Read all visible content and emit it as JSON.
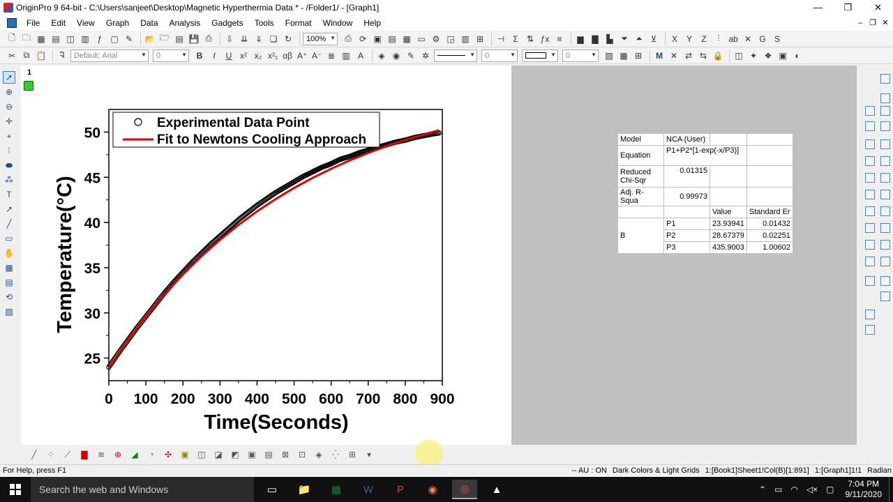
{
  "window": {
    "title": "OriginPro 9 64-bit - C:\\Users\\sanjeet\\Desktop\\Magnetic Hyperthermia Data * - /Folder1/ - [Graph1]",
    "minimize": "—",
    "maximize": "❐",
    "close": "✕"
  },
  "menu": {
    "items": [
      "File",
      "Edit",
      "View",
      "Graph",
      "Data",
      "Analysis",
      "Gadgets",
      "Tools",
      "Format",
      "Window",
      "Help"
    ],
    "mdi_min": "–",
    "mdi_restore": "❐",
    "mdi_close": "✕"
  },
  "toolbar": {
    "zoom": "100%",
    "font_name": "Default: Arial",
    "font_size": "0",
    "line_width": "0",
    "border_width": "0"
  },
  "page": {
    "layer_number": "1"
  },
  "chart_data": {
    "type": "scatter",
    "xlabel": "Time(Seconds)",
    "ylabel": "Temperature(°C)",
    "xlim": [
      0,
      900
    ],
    "ylim": [
      22.5,
      52.5
    ],
    "xticks": [
      0,
      100,
      200,
      300,
      400,
      500,
      600,
      700,
      800,
      900
    ],
    "yticks": [
      25,
      30,
      35,
      40,
      45,
      50
    ],
    "grid": false,
    "legend_position": "top-left",
    "legend": [
      {
        "label": "Experimental Data Point",
        "marker": "open-circle"
      },
      {
        "label": "Fit to Newtons Cooling Approach",
        "marker": "red-line"
      }
    ],
    "series": [
      {
        "name": "Experimental Data Point",
        "style": "black-open-circles",
        "x": [
          0,
          25,
          50,
          75,
          100,
          125,
          150,
          175,
          200,
          225,
          250,
          275,
          300,
          325,
          350,
          375,
          400,
          425,
          450,
          475,
          500,
          525,
          550,
          575,
          600,
          625,
          650,
          675,
          700,
          725,
          750,
          775,
          800,
          825,
          850,
          875,
          891
        ],
        "y": [
          24.0,
          25.5,
          26.9,
          28.3,
          29.6,
          30.9,
          32.2,
          33.4,
          34.5,
          35.6,
          36.6,
          37.6,
          38.5,
          39.4,
          40.3,
          41.1,
          41.9,
          42.6,
          43.3,
          43.9,
          44.5,
          45.1,
          45.6,
          46.1,
          46.5,
          47.0,
          47.3,
          47.7,
          48.0,
          48.3,
          48.6,
          48.9,
          49.1,
          49.4,
          49.6,
          49.8,
          49.9
        ]
      },
      {
        "name": "Fit to Newtons Cooling Approach",
        "style": "red-line",
        "x": [
          0,
          50,
          100,
          150,
          200,
          250,
          300,
          350,
          400,
          450,
          500,
          550,
          600,
          650,
          700,
          750,
          800,
          850,
          891
        ],
        "y": [
          23.94,
          26.91,
          29.6,
          32.04,
          34.25,
          36.26,
          38.08,
          39.73,
          41.23,
          42.58,
          43.82,
          44.93,
          45.94,
          46.86,
          47.69,
          48.44,
          49.12,
          49.74,
          50.2
        ]
      }
    ]
  },
  "fit_table": {
    "rows": [
      [
        "Model",
        "NCA (User)",
        "",
        ""
      ],
      [
        "Equation",
        "P1+P2*[1-exp(-x/P3)]",
        "",
        ""
      ],
      [
        "Reduced Chi-Sqr",
        "0.01315",
        "",
        ""
      ],
      [
        "Adj. R-Squa",
        "0.99973",
        "",
        ""
      ]
    ],
    "header": [
      "",
      "",
      "Value",
      "Standard Er"
    ],
    "group_label": "B",
    "params": [
      [
        "P1",
        "23.93941",
        "0.01432"
      ],
      [
        "P2",
        "28.67379",
        "0.02251"
      ],
      [
        "P3",
        "435.9003",
        "1.00602"
      ]
    ]
  },
  "status": {
    "help": "For Help, press F1",
    "au": "-- AU : ON",
    "theme": "Dark Colors & Light Grids",
    "book": "1:[Book1]Sheet1!Col(B)[1:891]",
    "graph": "1:[Graph1]1!1",
    "angle": "Radian"
  },
  "taskbar": {
    "search_placeholder": "Search the web and Windows",
    "time": "7:04 PM",
    "date": "9/11/2020"
  }
}
